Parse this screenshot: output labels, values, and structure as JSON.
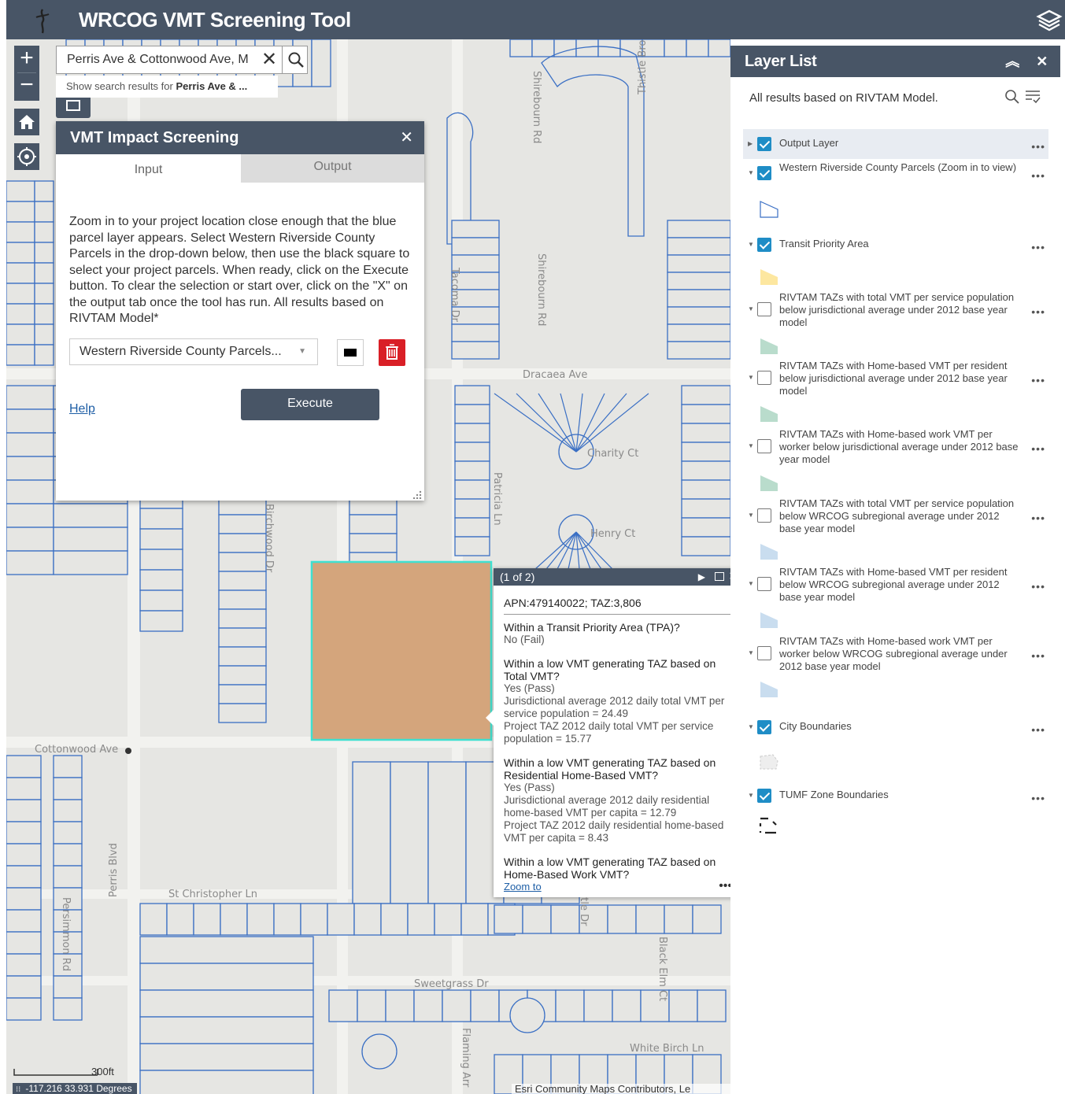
{
  "app": {
    "title": "WRCOG VMT Screening Tool"
  },
  "search": {
    "value": "Perris Ave & Cottonwood Ave, M",
    "suggest_prefix": "Show search results for ",
    "suggest_bold": "Perris Ave & ..."
  },
  "map": {
    "street_labels": [
      "Shirebourn Rd",
      "Thistle Brook Dr",
      "Shirebourn Rd",
      "Tacoma Dr",
      "Dracaea Ave",
      "Charity Ct",
      "Patricia Ln",
      "Henry Ct",
      "Birchwood Dr",
      "Cottonwood Ave",
      "St Christopher Ln",
      "Persimmon Rd",
      "Perris Blvd",
      "Myrtle Dr",
      "Black Elm Ct",
      "Sweetgrass Dr",
      "White Birch Ln",
      "Flaming Arr"
    ],
    "scale": "300ft",
    "coords": "-117.216 33.931 Degrees",
    "attribution": "Esri Community Maps Contributors, Le"
  },
  "panel": {
    "title": "VMT Impact Screening",
    "tab_input": "Input",
    "tab_output": "Output",
    "description": "Zoom in to your project location close enough that the blue parcel layer appears. Select Western Riverside County Parcels in the drop-down below, then use the black square to select your project parcels. When ready, click on the Execute button. To clear the selection or start over, click on the \"X\" on the output tab once the tool has run. All results based on RIVTAM Model*",
    "dropdown": "Western Riverside County Parcels...",
    "help": "Help",
    "execute": "Execute"
  },
  "popup": {
    "counter": "(1 of 2)",
    "title": "APN:479140022; TAZ:3,806",
    "items": [
      {
        "q": "Within a Transit Priority Area (TPA)?",
        "a": "No (Fail)"
      },
      {
        "q": "Within a low VMT generating TAZ based on Total VMT?",
        "a": "Yes (Pass)",
        "d": "Jurisdictional average 2012 daily total VMT per service population = 24.49",
        "e": "Project TAZ 2012 daily total VMT per service population = 15.77"
      },
      {
        "q": "Within a low VMT generating TAZ based on Residential Home-Based VMT?",
        "a": "Yes (Pass)",
        "d": "Jurisdictional average 2012 daily residential home-based VMT per capita = 12.79",
        "e": "Project TAZ 2012 daily residential home-based VMT per capita = 8.43"
      },
      {
        "q": "Within a low VMT generating TAZ based on Home-Based Work VMT?"
      }
    ],
    "zoom_to": "Zoom to",
    "more": "•••"
  },
  "layer_list": {
    "title": "Layer List",
    "subtitle": "All results based on RIVTAM Model.",
    "layers": [
      {
        "label": "Output Layer",
        "checked": true
      },
      {
        "label": "Western Riverside County Parcels (Zoom in to view)",
        "checked": true
      },
      {
        "label": "Transit Priority Area",
        "checked": true
      },
      {
        "label": "RIVTAM TAZs with total VMT per service population below jurisdictional average under 2012 base year model",
        "checked": false
      },
      {
        "label": "RIVTAM TAZs with Home-based VMT per resident below jurisdictional average under 2012 base year model",
        "checked": false
      },
      {
        "label": "RIVTAM TAZs with Home-based work VMT per worker below jurisdictional average under 2012 base year model",
        "checked": false
      },
      {
        "label": "RIVTAM TAZs with total VMT per service population below WRCOG subregional average under 2012 base year model",
        "checked": false
      },
      {
        "label": "RIVTAM TAZs with Home-based VMT per resident below WRCOG subregional average under 2012 base year model",
        "checked": false
      },
      {
        "label": "RIVTAM TAZs with Home-based work VMT per worker below WRCOG subregional average under 2012 base year model",
        "checked": false
      },
      {
        "label": "City Boundaries",
        "checked": true
      },
      {
        "label": "TUMF Zone Boundaries",
        "checked": true
      }
    ],
    "more": "•••"
  },
  "colors": {
    "header": "#485566",
    "parcel_line": "#3a6fc4",
    "selected_parcel": "#d4a57c",
    "selected_outline": "#40e0d0",
    "check": "#1f8dc6",
    "delete": "#d91f26"
  }
}
